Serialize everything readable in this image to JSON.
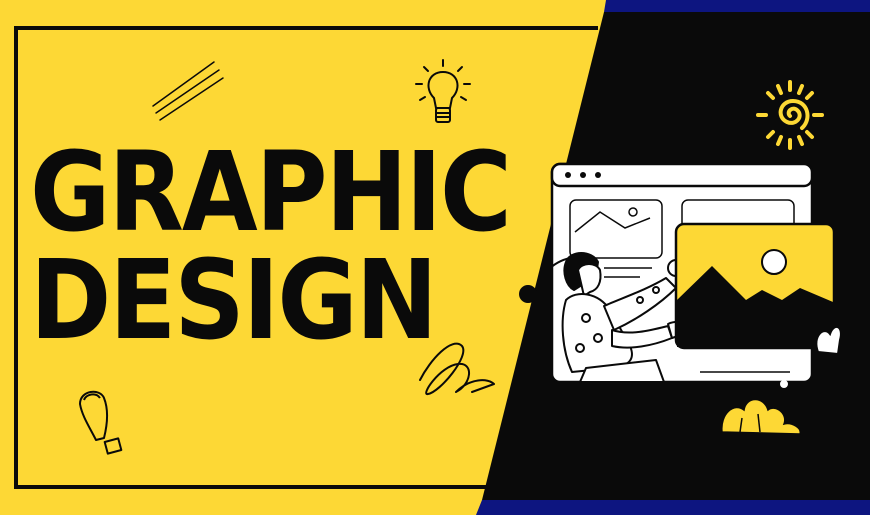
{
  "headline": {
    "line1": "GRAPHIC",
    "line2": "DESIGN"
  },
  "colors": {
    "yellow": "#fdd835",
    "black": "#0a0a0a",
    "navy": "#0d1580",
    "white": "#ffffff"
  },
  "icons": [
    "hatch-lines-icon",
    "lightbulb-icon",
    "sun-spiral-icon",
    "scribble-icon",
    "exclamation-icon",
    "bush-icon",
    "sparkle-icon"
  ]
}
